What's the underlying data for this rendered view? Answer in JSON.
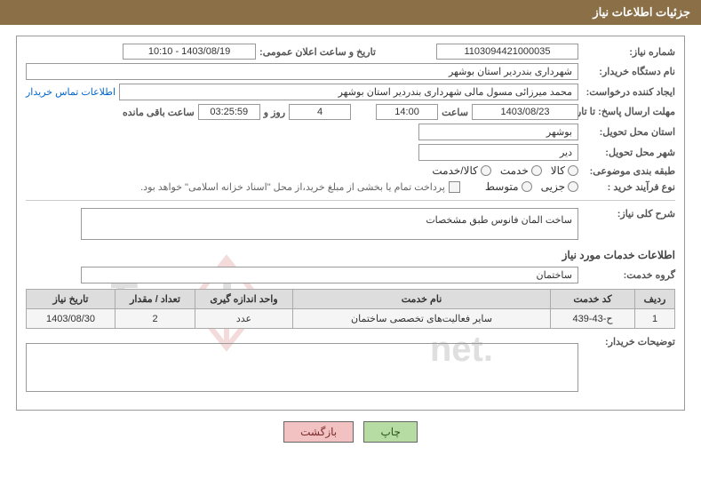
{
  "header": {
    "title": "جزئیات اطلاعات نیاز"
  },
  "labels": {
    "needNo": "شماره نیاز:",
    "announceDate": "تاریخ و ساعت اعلان عمومی:",
    "buyerOrg": "نام دستگاه خریدار:",
    "requester": "ایجاد کننده درخواست:",
    "contactLink": "اطلاعات تماس خریدار",
    "deadline": "مهلت ارسال پاسخ: تا تاریخ:",
    "hour": "ساعت",
    "daysAnd": "روز و",
    "remaining": "ساعت باقی مانده",
    "deliveryProvince": "استان محل تحویل:",
    "deliveryCity": "شهر محل تحویل:",
    "category": "طبقه بندی موضوعی:",
    "cat_goods": "کالا",
    "cat_service": "خدمت",
    "cat_goodsService": "کالا/خدمت",
    "procType": "نوع فرآیند خرید :",
    "proc_minor": "جزیی",
    "proc_medium": "متوسط",
    "treasuryNote": "پرداخت تمام یا بخشی از مبلغ خرید،از محل \"اسناد خزانه اسلامی\" خواهد بود.",
    "needDesc": "شرح کلی نیاز:",
    "serviceInfo": "اطلاعات خدمات مورد نیاز",
    "serviceGroup": "گروه خدمت:",
    "buyerNotes": "توضیحات خریدار:",
    "printBtn": "چاپ",
    "backBtn": "بازگشت"
  },
  "values": {
    "needNo": "1103094421000035",
    "announceDate": "1403/08/19 - 10:10",
    "buyerOrg": "شهرداری بندردیر استان بوشهر",
    "requester": "محمد میرزائی مسول مالی شهرداری بندردیر استان بوشهر",
    "deadlineDate": "1403/08/23",
    "deadlineHour": "14:00",
    "remainingDays": "4",
    "remainingTime": "03:25:59",
    "deliveryProvince": "بوشهر",
    "deliveryCity": "دیر",
    "needDesc": "ساخت المان فانوس طبق مشخصات",
    "serviceGroup": "ساختمان"
  },
  "table": {
    "headers": {
      "row": "ردیف",
      "code": "کد خدمت",
      "name": "نام خدمت",
      "unit": "واحد اندازه گیری",
      "qty": "تعداد / مقدار",
      "needDate": "تاریخ نیاز"
    },
    "rows": [
      {
        "row": "1",
        "code": "ح-43-439",
        "name": "سایر فعالیت‌های تخصصی ساختمان",
        "unit": "عدد",
        "qty": "2",
        "needDate": "1403/08/30"
      }
    ]
  },
  "watermark": "AriaTender.net"
}
